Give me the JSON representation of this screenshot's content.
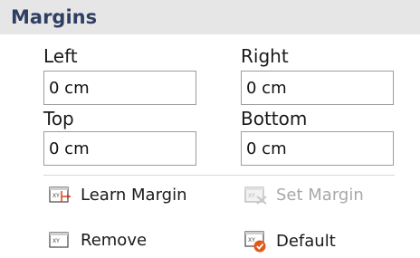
{
  "panel": {
    "title": "Margins"
  },
  "fields": {
    "left": {
      "label": "Left",
      "value": "0 cm"
    },
    "right": {
      "label": "Right",
      "value": "0 cm"
    },
    "top": {
      "label": "Top",
      "value": "0 cm"
    },
    "bottom": {
      "label": "Bottom",
      "value": "0 cm"
    }
  },
  "actions": {
    "learn_margin": {
      "label": "Learn Margin",
      "icon": "learn-margin-icon",
      "enabled": true
    },
    "set_margin": {
      "label": "Set Margin",
      "icon": "set-margin-icon",
      "enabled": false
    },
    "remove": {
      "label": "Remove",
      "icon": "remove-margin-icon",
      "enabled": true
    },
    "default": {
      "label": "Default",
      "icon": "default-margin-icon",
      "enabled": true
    }
  },
  "colors": {
    "title": "#2e3f63",
    "header_bg": "#e6e6e6",
    "disabled_text": "#a8a8a8",
    "icon_accent_red": "#d9401f",
    "icon_accent_orange": "#e05a1a"
  }
}
